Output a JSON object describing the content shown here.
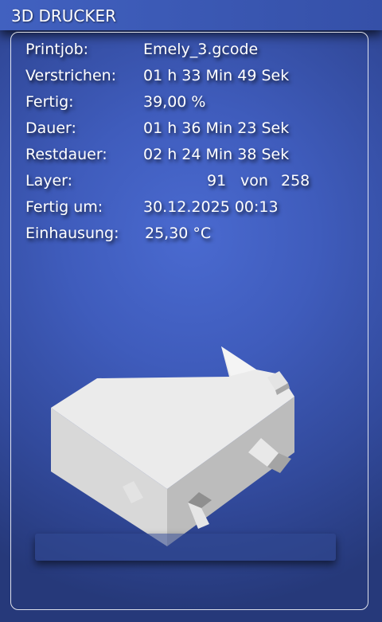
{
  "header": {
    "title": "3D DRUCKER"
  },
  "info": {
    "printjob": {
      "label": "Printjob:",
      "value": "Emely_3.gcode"
    },
    "elapsed": {
      "label": "Verstrichen:",
      "value": "01 h 33 Min 49 Sek"
    },
    "progress": {
      "label": "Fertig:",
      "value": "39,00 %"
    },
    "duration": {
      "label": "Dauer:",
      "value": "01 h 36 Min 23 Sek"
    },
    "remaining": {
      "label": "Restdauer:",
      "value": "02 h 24 Min 38 Sek"
    },
    "layer": {
      "label": "Layer:",
      "current": "91",
      "separator": "von",
      "total": "258"
    },
    "finish_at": {
      "label": "Fertig um:",
      "value": "30.12.2025 00:13"
    },
    "enclosure": {
      "label": "Einhausung:",
      "value": "25,30 °C"
    }
  },
  "colors": {
    "background": "#4060c0",
    "model_light": "#e6e6e6",
    "model_side": "#c8c8c8",
    "model_dark": "#a8a8a8",
    "text": "#ffffff"
  },
  "icons": {
    "model_preview": "3d-print-model-preview"
  }
}
